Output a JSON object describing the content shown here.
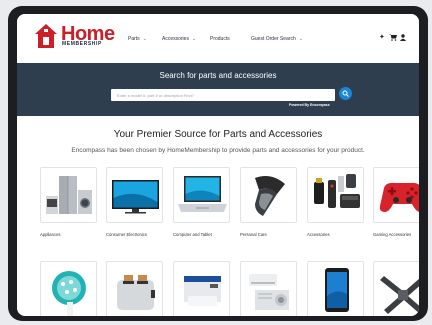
{
  "brand": {
    "name": "Home",
    "sub": "MEMBERSHIP"
  },
  "nav": [
    {
      "label": "Parts",
      "dropdown": true
    },
    {
      "label": "Accessories",
      "dropdown": true
    },
    {
      "label": "Products",
      "dropdown": false
    },
    {
      "label": "Guest Order Search",
      "dropdown": true
    }
  ],
  "header_icons": [
    "info-icon",
    "cart-icon",
    "user-icon"
  ],
  "search": {
    "title": "Search for parts and accessories",
    "placeholder": "Enter a model #, part # or description Find?",
    "powered_by": "Powered By Encompass"
  },
  "headline": "Your Premier Source for Parts and Accessories",
  "subhead": "Encompass has been chosen by HomeMembership to provide parts and accessories for your product.",
  "categories": [
    {
      "label": "Appliances"
    },
    {
      "label": "Consumer Electronics"
    },
    {
      "label": "Computer and Tablet"
    },
    {
      "label": "Personal Care"
    },
    {
      "label": "Accessories"
    },
    {
      "label": "Gaming Accessories"
    }
  ],
  "colors": {
    "brand_red": "#cc1f27",
    "band": "#2f3e4e",
    "accent_blue": "#1a86d9"
  }
}
